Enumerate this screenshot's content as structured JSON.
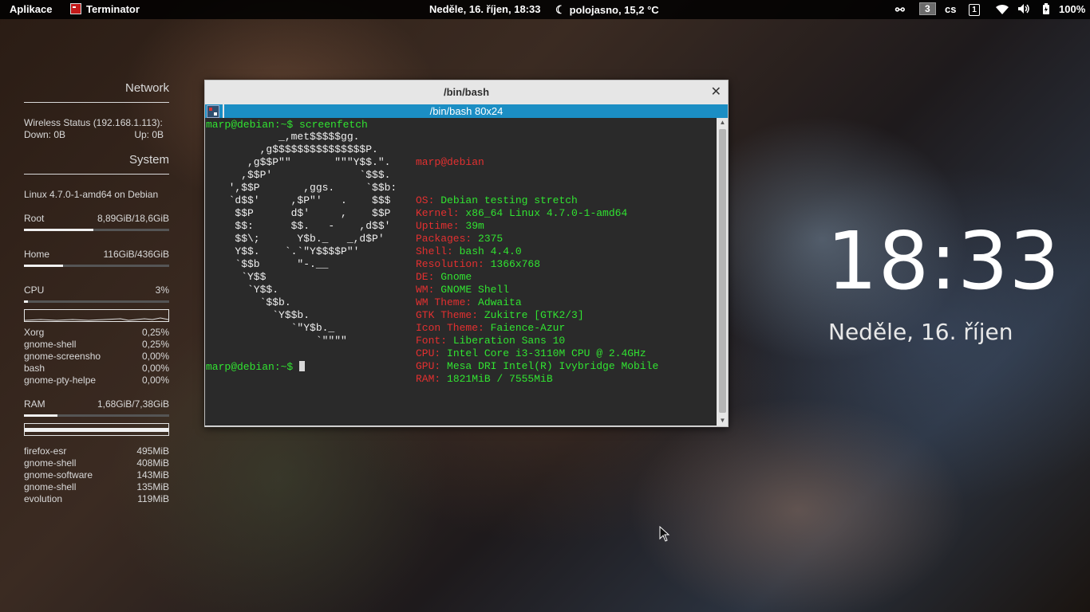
{
  "topbar": {
    "apps_menu": "Aplikace",
    "active_app": "Terminator",
    "datetime": "Neděle, 16. říjen, 18:33",
    "weather": "polojasno, 15,2 °C",
    "workspace": "3",
    "keyboard_layout": "cs",
    "keyboard_icon_label": "1",
    "battery": "100%"
  },
  "conky": {
    "network_title": "Network",
    "wireless_status": "Wireless Status (192.168.1.113):",
    "down": "Down: 0B",
    "up": "Up: 0B",
    "system_title": "System",
    "kernel": "Linux 4.7.0-1-amd64 on Debian",
    "root_label": "Root",
    "root_value": "8,89GiB/18,6GiB",
    "root_usage": 0.48,
    "home_label": "Home",
    "home_value": "116GiB/436GiB",
    "home_usage": 0.27,
    "cpu_label": "CPU",
    "cpu_value": "3%",
    "cpu_usage": 0.03,
    "cpu_procs": [
      {
        "name": "Xorg",
        "value": "0,25%"
      },
      {
        "name": "gnome-shell",
        "value": "0,25%"
      },
      {
        "name": "gnome-screensho",
        "value": "0,00%"
      },
      {
        "name": "bash",
        "value": "0,00%"
      },
      {
        "name": "gnome-pty-helpe",
        "value": "0,00%"
      }
    ],
    "ram_label": "RAM",
    "ram_value": "1,68GiB/7,38GiB",
    "ram_usage": 0.23,
    "ram_procs": [
      {
        "name": "firefox-esr",
        "value": "495MiB"
      },
      {
        "name": "gnome-shell",
        "value": "408MiB"
      },
      {
        "name": "gnome-software",
        "value": "143MiB"
      },
      {
        "name": "gnome-shell",
        "value": "135MiB"
      },
      {
        "name": "evolution",
        "value": "119MiB"
      }
    ]
  },
  "terminal": {
    "window_title": "/bin/bash",
    "tab_title": "/bin/bash 80x24",
    "prompt1": "marp@debian:~$ screenfetch",
    "prompt2": "marp@debian:~$ ",
    "user_host": "marp@debian",
    "ascii": "          _,met$$$$$gg.\n       ,g$$$$$$$$$$$$$$$P.\n     ,g$$P\"\"       \"\"\"Y$$.\".\n    ,$$P'              `$$$.\n  ',$$P       ,ggs.     `$$b:\n  `d$$'     ,$P\"'   .    $$$\n   $$P      d$'     ,    $$P\n   $$:      $$.   -    ,d$$'\n   $$\\;      Y$b._   _,d$P'\n   Y$$.    `.`\"Y$$$$P\"'\n   `$$b      \"-.__\n    `Y$$\n     `Y$$.\n       `$$b.\n         `Y$$b.\n            `\"Y$b._\n                `\"\"\"\"",
    "info": [
      {
        "key": "OS: ",
        "value": "Debian testing stretch"
      },
      {
        "key": "Kernel: ",
        "value": "x86_64 Linux 4.7.0-1-amd64"
      },
      {
        "key": "Uptime: ",
        "value": "39m"
      },
      {
        "key": "Packages: ",
        "value": "2375"
      },
      {
        "key": "Shell: ",
        "value": "bash 4.4.0"
      },
      {
        "key": "Resolution: ",
        "value": "1366x768"
      },
      {
        "key": "DE: ",
        "value": "Gnome"
      },
      {
        "key": "WM: ",
        "value": "GNOME Shell"
      },
      {
        "key": "WM Theme: ",
        "value": "Adwaita"
      },
      {
        "key": "GTK Theme: ",
        "value": "Zukitre [GTK2/3]"
      },
      {
        "key": "Icon Theme: ",
        "value": "Faience-Azur"
      },
      {
        "key": "Font: ",
        "value": "Liberation Sans 10"
      },
      {
        "key": "CPU: ",
        "value": "Intel Core i3-3110M CPU @ 2.4GHz"
      },
      {
        "key": "GPU: ",
        "value": "Mesa DRI Intel(R) Ivybridge Mobile"
      },
      {
        "key": "RAM: ",
        "value": "1821MiB / 7555MiB"
      }
    ]
  },
  "lockclock": {
    "time": "18:33",
    "date": "Neděle, 16. říjen"
  }
}
